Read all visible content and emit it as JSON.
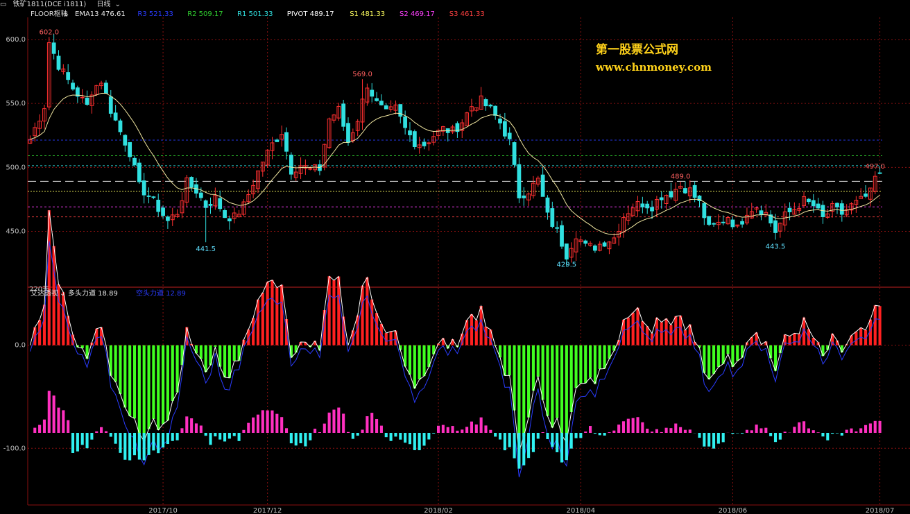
{
  "window": {
    "instrument": "铁矿1811(DCE i1811)",
    "period": "日线"
  },
  "indicator_bar": {
    "name": "FLOOR枢轴",
    "items": [
      {
        "text": "EMA13 476.61",
        "color": "#e8e8e8"
      },
      {
        "text": "R3 521.33",
        "color": "#2a3cff"
      },
      {
        "text": "R2 509.17",
        "color": "#30d030"
      },
      {
        "text": "R1 501.33",
        "color": "#30e0e0"
      },
      {
        "text": "PIVOT 489.17",
        "color": "#ffffff"
      },
      {
        "text": "S1 481.33",
        "color": "#ffff60"
      },
      {
        "text": "S2 469.17",
        "color": "#ff40ff"
      },
      {
        "text": "S3 461.33",
        "color": "#ff4040"
      }
    ]
  },
  "sub_indicator_bar": {
    "name": "艾达透视",
    "items": [
      {
        "text": "多头力道 18.89",
        "color": "#e8e8e8"
      },
      {
        "text": "空头力道 12.89",
        "color": "#2a3cff"
      }
    ]
  },
  "watermark": {
    "line1": "第一股票公式网",
    "line2": "www.chnmoney.com"
  },
  "colors": {
    "up": "#ff3030",
    "down": "#30e0e0",
    "bull_bar": "#ff2020",
    "bear_bar": "#40ff20",
    "magenta": "#ff30c0",
    "cyan": "#30f0f0",
    "grid": "#8a1010",
    "axis_text": "#c0c0c0"
  },
  "chart_data": [
    {
      "type": "candlestick",
      "title": "铁矿1811 日线",
      "y_ticks": [
        "600.0",
        "550.0",
        "500.0",
        "450.0"
      ],
      "ylim": [
        408,
        613
      ],
      "x_tick_labels": [
        "2017/10",
        "2017/12",
        "2018/02",
        "2018/04",
        "2018/06",
        "2018/07"
      ],
      "x_tick_bar_index": [
        28,
        50,
        86,
        116,
        148,
        179
      ],
      "bar_count": 180,
      "period_label": "220天",
      "annotations": [
        {
          "text": "602.0",
          "bar": 4,
          "value": 602.0
        },
        {
          "text": "441.5",
          "bar": 37,
          "value": 441.5
        },
        {
          "text": "569.0",
          "bar": 70,
          "value": 569.0
        },
        {
          "text": "429.5",
          "bar": 113,
          "value": 429.5
        },
        {
          "text": "489.0",
          "bar": 137,
          "value": 489.0
        },
        {
          "text": "443.5",
          "bar": 157,
          "value": 443.5
        },
        {
          "text": "497.0",
          "bar": 178,
          "value": 497.0
        }
      ],
      "pivot_levels": [
        {
          "name": "R3",
          "value": 521.33
        },
        {
          "name": "R2",
          "value": 509.17
        },
        {
          "name": "R1",
          "value": 501.33
        },
        {
          "name": "PIVOT",
          "value": 489.17
        },
        {
          "name": "S1",
          "value": 481.33
        },
        {
          "name": "S2",
          "value": 469.17
        },
        {
          "name": "S3",
          "value": 461.33
        }
      ],
      "close_anchors": [
        [
          0,
          522
        ],
        [
          3,
          548
        ],
        [
          4,
          598
        ],
        [
          6,
          580
        ],
        [
          9,
          562
        ],
        [
          12,
          548
        ],
        [
          13,
          560
        ],
        [
          15,
          568
        ],
        [
          17,
          545
        ],
        [
          19,
          528
        ],
        [
          21,
          512
        ],
        [
          23,
          485
        ],
        [
          25,
          478
        ],
        [
          27,
          468
        ],
        [
          29,
          458
        ],
        [
          31,
          465
        ],
        [
          33,
          488
        ],
        [
          35,
          482
        ],
        [
          37,
          470
        ],
        [
          39,
          476
        ],
        [
          41,
          462
        ],
        [
          43,
          461
        ],
        [
          45,
          470
        ],
        [
          47,
          488
        ],
        [
          49,
          505
        ],
        [
          51,
          518
        ],
        [
          53,
          528
        ],
        [
          55,
          498
        ],
        [
          57,
          502
        ],
        [
          59,
          498
        ],
        [
          61,
          499
        ],
        [
          63,
          538
        ],
        [
          65,
          545
        ],
        [
          67,
          520
        ],
        [
          69,
          538
        ],
        [
          71,
          565
        ],
        [
          73,
          550
        ],
        [
          75,
          542
        ],
        [
          77,
          546
        ],
        [
          79,
          530
        ],
        [
          81,
          520
        ],
        [
          83,
          518
        ],
        [
          85,
          525
        ],
        [
          87,
          530
        ],
        [
          89,
          528
        ],
        [
          91,
          536
        ],
        [
          93,
          548
        ],
        [
          95,
          552
        ],
        [
          97,
          545
        ],
        [
          99,
          535
        ],
        [
          101,
          520
        ],
        [
          103,
          478
        ],
        [
          105,
          482
        ],
        [
          107,
          490
        ],
        [
          109,
          462
        ],
        [
          111,
          450
        ],
        [
          113,
          432
        ],
        [
          115,
          448
        ],
        [
          117,
          438
        ],
        [
          119,
          438
        ],
        [
          121,
          442
        ],
        [
          123,
          445
        ],
        [
          125,
          462
        ],
        [
          127,
          470
        ],
        [
          129,
          472
        ],
        [
          131,
          470
        ],
        [
          133,
          478
        ],
        [
          135,
          480
        ],
        [
          137,
          486
        ],
        [
          139,
          482
        ],
        [
          141,
          472
        ],
        [
          143,
          452
        ],
        [
          145,
          456
        ],
        [
          147,
          462
        ],
        [
          149,
          452
        ],
        [
          151,
          466
        ],
        [
          153,
          470
        ],
        [
          155,
          464
        ],
        [
          157,
          450
        ],
        [
          159,
          462
        ],
        [
          161,
          468
        ],
        [
          163,
          474
        ],
        [
          165,
          470
        ],
        [
          167,
          460
        ],
        [
          169,
          468
        ],
        [
          171,
          464
        ],
        [
          173,
          470
        ],
        [
          175,
          474
        ],
        [
          177,
          480
        ],
        [
          178,
          492
        ],
        [
          179,
          493
        ]
      ],
      "ema_period": 13
    },
    {
      "type": "bar",
      "title": "艾达透视",
      "series": [
        {
          "name": "多头力道",
          "last": 18.89
        },
        {
          "name": "空头力道",
          "last": 12.89
        }
      ],
      "y_ticks": [
        "0.0",
        "-100.0"
      ],
      "ylim": [
        -155,
        55
      ]
    }
  ]
}
